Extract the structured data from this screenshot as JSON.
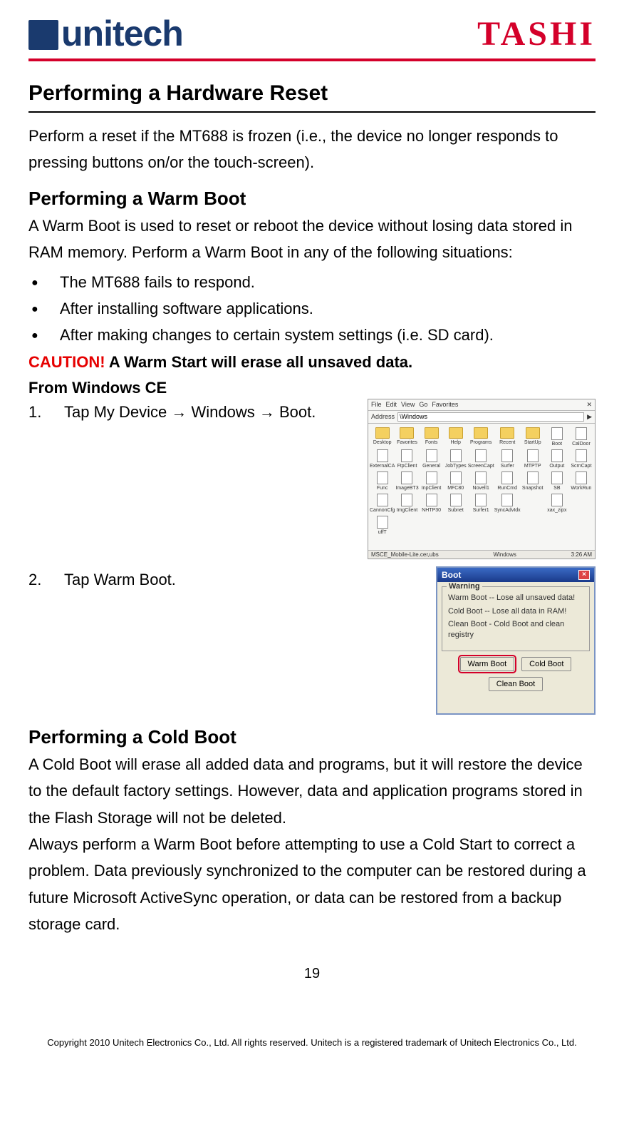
{
  "header": {
    "logo_left": "unitech",
    "logo_right": "TASHI"
  },
  "title": "Performing a Hardware Reset",
  "intro": "Perform a reset if the MT688 is frozen (i.e., the device no longer responds to pressing buttons on/or the touch-screen).",
  "warm": {
    "heading": "Performing a Warm Boot",
    "desc": "A Warm Boot is used to reset or reboot the device without losing data stored in RAM memory. Perform a Warm Boot in any of the following situations:",
    "bullets": [
      "The MT688 fails to respond.",
      "After installing software applications.",
      "After making changes to certain system settings (i.e. SD card)."
    ],
    "caution_label": "CAUTION!",
    "caution_text": " A Warm Start will erase all unsaved data.",
    "from_heading": "From Windows CE",
    "step1_num": "1.",
    "step1_text": "Tap My Device → Windows → Boot.",
    "step2_num": "2.",
    "step2_text": "Tap Warm Boot."
  },
  "explorer": {
    "menu": [
      "File",
      "Edit",
      "View",
      "Go",
      "Favorites"
    ],
    "addr_label": "Address",
    "addr_value": "\\Windows",
    "icons_row1": [
      "Desktop",
      "Favorites",
      "Fonts",
      "Help",
      "Programs",
      "Recent",
      "StartUp",
      "Boot",
      "CalDoor"
    ],
    "icons_row2": [
      "ExternalCA",
      "FtpClient",
      "General",
      "JobTypes",
      "ScreenCapt",
      "Surfer",
      "MTPTP",
      "Output",
      "ScrnCapt"
    ],
    "icons_row3": [
      "Func",
      "ImageBT3",
      "InpClient",
      "MFC80",
      "Novell1",
      "RunCmd",
      "Snapshot",
      "SB",
      "WorkRun"
    ],
    "icons_row4": [
      "CannonCfg",
      "ImgClient",
      "NHTP30",
      "Subnet",
      "Surfer1",
      "SyncAdvIdx",
      "",
      "xax_zipx",
      ""
    ],
    "icons_row5": [
      "uffT",
      "",
      "",
      "",
      "",
      "",
      "",
      "",
      ""
    ],
    "status_left": "MSCE_Mobile-Lite.cer,ubs",
    "status_center": "Windows",
    "status_right": "3:26 AM"
  },
  "boot_dialog": {
    "title": "Boot",
    "group_label": "Warning",
    "line1": "Warm Boot -- Lose all unsaved data!",
    "line2": "Cold Boot -- Lose all data in RAM!",
    "line3": "Clean Boot - Cold Boot and clean registry",
    "btn_warm": "Warm Boot",
    "btn_cold": "Cold Boot",
    "btn_clean": "Clean Boot"
  },
  "cold": {
    "heading": "Performing a Cold Boot",
    "p1": "A Cold Boot will erase all added data and programs, but it will restore the device to the default factory settings. However, data and application programs stored in the Flash Storage will not be deleted.",
    "p2": "Always perform a Warm Boot before attempting to use a Cold Start to correct a problem. Data previously synchronized to the computer can be restored during a future Microsoft ActiveSync operation, or data can be restored from a backup storage card."
  },
  "page_number": "19",
  "footer": "Copyright 2010 Unitech Electronics Co., Ltd. All rights reserved. Unitech is a registered trademark of Unitech Electronics Co., Ltd."
}
